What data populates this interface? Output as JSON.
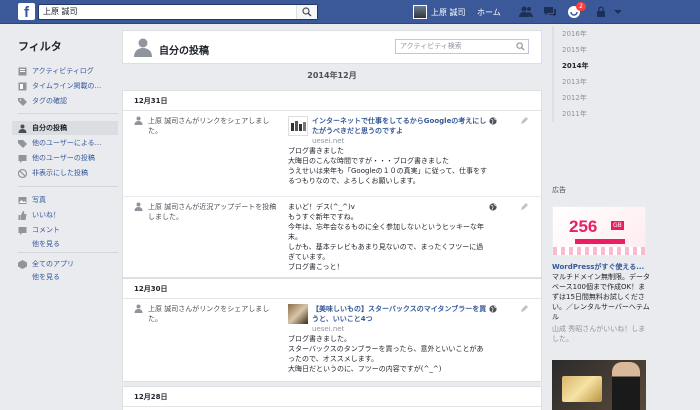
{
  "topbar": {
    "search_value": "上原 誠司",
    "profile_name": "上原 誠司",
    "home_label": "ホーム",
    "notification_count": "2",
    "icons": [
      "friends-icon",
      "messages-icon",
      "notifications-icon",
      "privacy-lock-icon",
      "account-menu-chevron-icon"
    ]
  },
  "filter": {
    "title": "フィルタ",
    "items": [
      {
        "label": "アクティビティログ",
        "icon": "activity-log-icon"
      },
      {
        "label": "タイムライン掲載の...",
        "icon": "timeline-review-icon"
      },
      {
        "label": "タグの確認",
        "icon": "tag-review-icon"
      },
      {
        "label": "自分の投稿",
        "icon": "your-posts-icon"
      },
      {
        "label": "他のユーザーによる...",
        "icon": "posts-by-others-icon"
      },
      {
        "label": "他のユーザーの投稿",
        "icon": "others-posts-icon"
      },
      {
        "label": "非表示にした投稿",
        "icon": "hidden-posts-icon"
      },
      {
        "label": "写真",
        "icon": "photos-icon"
      },
      {
        "label": "いいね！",
        "icon": "likes-icon"
      },
      {
        "label": "コメント",
        "icon": "comments-icon"
      },
      {
        "label": "全てのアプリ",
        "icon": "apps-icon"
      }
    ],
    "see_more_1": "他を見る",
    "see_more_2": "他を見る"
  },
  "header": {
    "title": "自分の投稿",
    "search_placeholder": "アクティビティ検索"
  },
  "month": "2014年12月",
  "days": [
    {
      "date": "12月31日",
      "entries": [
        {
          "summary": "上原 誠司さんがリンクをシェアしました。",
          "link_title": "インターネットで仕事をしてるからGoogleの考えにしたがうべきだと思うのですよ",
          "domain": "uesei.net",
          "lines": [
            "ブログ書きました",
            "大晦日のこんな時間ですが・・・ブログ書きました",
            "うえせいは来年も「Googleの１０の真実」に従って、仕事をするつもりなので、よろしくお願いします。"
          ]
        },
        {
          "summary": "上原 誠司さんが近況アップデートを投稿しました。",
          "lines": [
            "まいど！デス(^_^)v",
            "もうすぐ新年ですね。",
            "今年は、忘年会なるものに全く参加しないというヒッキーな年末。",
            "しかも、基本テレビもあまり見ないので、まったくフツーに過ぎています。",
            "ブログ書こっと！"
          ]
        }
      ]
    },
    {
      "date": "12月30日",
      "entries": [
        {
          "summary": "上原 誠司さんがリンクをシェアしました。",
          "link_title": "【美味しいもの】スターバックスのマイタンブラーを買うと、いいこと4つ",
          "domain": "uesei.net",
          "lines": [
            "ブログ書きました。",
            "スターバックスのタンブラーを買ったら、意外といいことがあったので、オススメします。",
            "大晦日だというのに、フツーの内容ですが(^_^)"
          ]
        }
      ]
    },
    {
      "date": "12月28日",
      "entries": []
    }
  ],
  "years": [
    "2016年",
    "2015年",
    "2014年",
    "2013年",
    "2012年",
    "2011年"
  ],
  "active_year": "2014年",
  "ad": {
    "heading": "広告",
    "img_number": "256",
    "img_unit": "GB",
    "title": "WordPressがすぐ使える...",
    "body": "マルチドメイン無制限。データベース100個まで作成OK！まずは15日間無料お試しください。／レンタルサーバーヘテムル",
    "like_text": "山成 秀昭さんがいいね！しました。"
  }
}
